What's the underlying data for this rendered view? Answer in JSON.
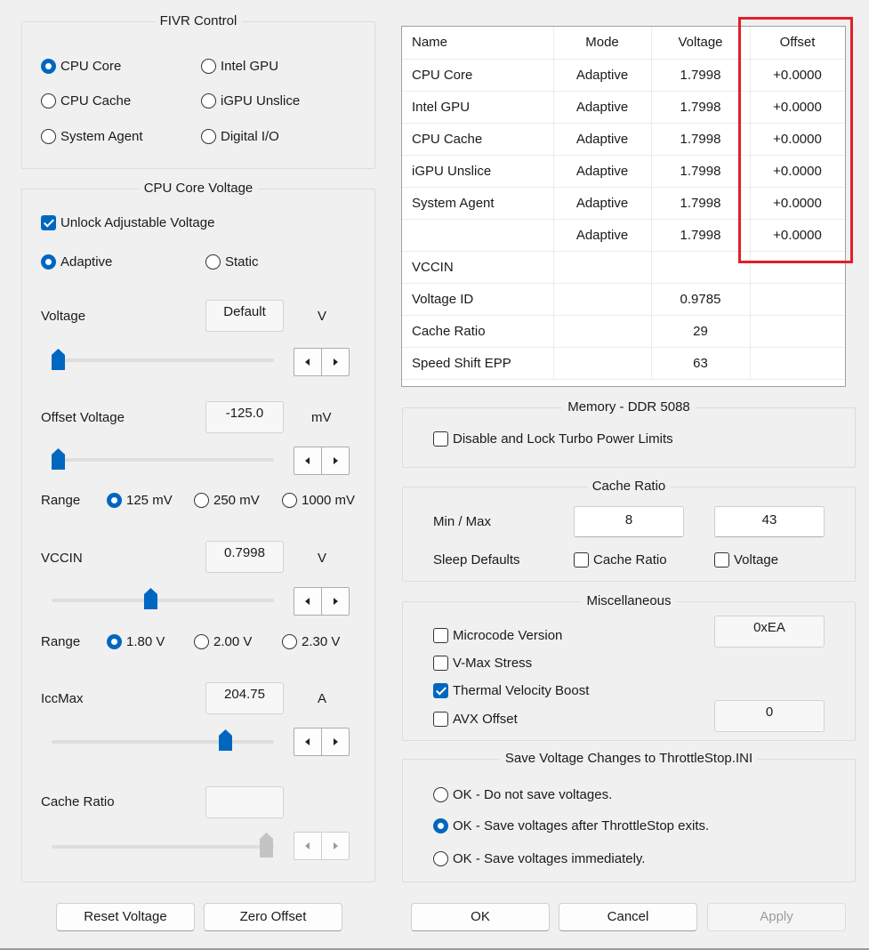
{
  "fivr": {
    "title": "FIVR Control",
    "options": [
      {
        "label": "CPU Core",
        "checked": true
      },
      {
        "label": "Intel GPU",
        "checked": false
      },
      {
        "label": "CPU Cache",
        "checked": false
      },
      {
        "label": "iGPU Unslice",
        "checked": false
      },
      {
        "label": "System Agent",
        "checked": false
      },
      {
        "label": "Digital I/O",
        "checked": false
      }
    ]
  },
  "core_voltage": {
    "title": "CPU Core Voltage",
    "unlock_label": "Unlock Adjustable Voltage",
    "mode_adaptive": "Adaptive",
    "mode_static": "Static",
    "voltage_label": "Voltage",
    "voltage_value": "Default",
    "voltage_unit": "V",
    "offset_label": "Offset Voltage",
    "offset_value": "-125.0",
    "offset_unit": "mV",
    "range_label": "Range",
    "range_opts": [
      "125 mV",
      "250 mV",
      "1000 mV"
    ],
    "vccin_label": "VCCIN",
    "vccin_value": "0.7998",
    "vccin_unit": "V",
    "vccin_range_label": "Range",
    "vccin_range_opts": [
      "1.80 V",
      "2.00 V",
      "2.30 V"
    ],
    "iccmax_label": "IccMax",
    "iccmax_value": "204.75",
    "iccmax_unit": "A",
    "cache_ratio_label": "Cache Ratio",
    "cache_ratio_value": ""
  },
  "buttons_left": {
    "reset": "Reset Voltage",
    "zero": "Zero Offset"
  },
  "grid": {
    "headers": [
      "Name",
      "Mode",
      "Voltage",
      "Offset"
    ],
    "rows": [
      [
        "CPU Core",
        "Adaptive",
        "1.7998",
        "+0.0000"
      ],
      [
        "Intel GPU",
        "Adaptive",
        "1.7998",
        "+0.0000"
      ],
      [
        "CPU Cache",
        "Adaptive",
        "1.7998",
        "+0.0000"
      ],
      [
        "iGPU Unslice",
        "Adaptive",
        "1.7998",
        "+0.0000"
      ],
      [
        "System Agent",
        "Adaptive",
        "1.7998",
        "+0.0000"
      ],
      [
        "",
        "Adaptive",
        "1.7998",
        "+0.0000"
      ],
      [
        "VCCIN",
        "",
        "",
        ""
      ],
      [
        "Voltage ID",
        "",
        "0.9785",
        ""
      ],
      [
        "Cache Ratio",
        "",
        "29",
        ""
      ],
      [
        "Speed Shift EPP",
        "",
        "63",
        ""
      ]
    ]
  },
  "memory": {
    "title": "Memory - DDR 5088",
    "disable_lock": "Disable and Lock Turbo Power Limits"
  },
  "cache_ratio": {
    "title": "Cache Ratio",
    "minmax_label": "Min / Max",
    "min": "8",
    "max": "43",
    "sleep_label": "Sleep Defaults",
    "sleep_cache": "Cache Ratio",
    "sleep_voltage": "Voltage"
  },
  "misc": {
    "title": "Miscellaneous",
    "microcode": "Microcode Version",
    "microcode_value": "0xEA",
    "vmax": "V-Max Stress",
    "tvb": "Thermal Velocity Boost",
    "avx": "AVX Offset",
    "avx_value": "0"
  },
  "save": {
    "title": "Save Voltage Changes to ThrottleStop.INI",
    "opts": [
      "OK - Do not save voltages.",
      "OK - Save voltages after ThrottleStop exits.",
      "OK - Save voltages immediately."
    ]
  },
  "dialog_buttons": {
    "ok": "OK",
    "cancel": "Cancel",
    "apply": "Apply"
  },
  "colors": {
    "accent": "#0067c0",
    "highlight": "#e0202a"
  }
}
